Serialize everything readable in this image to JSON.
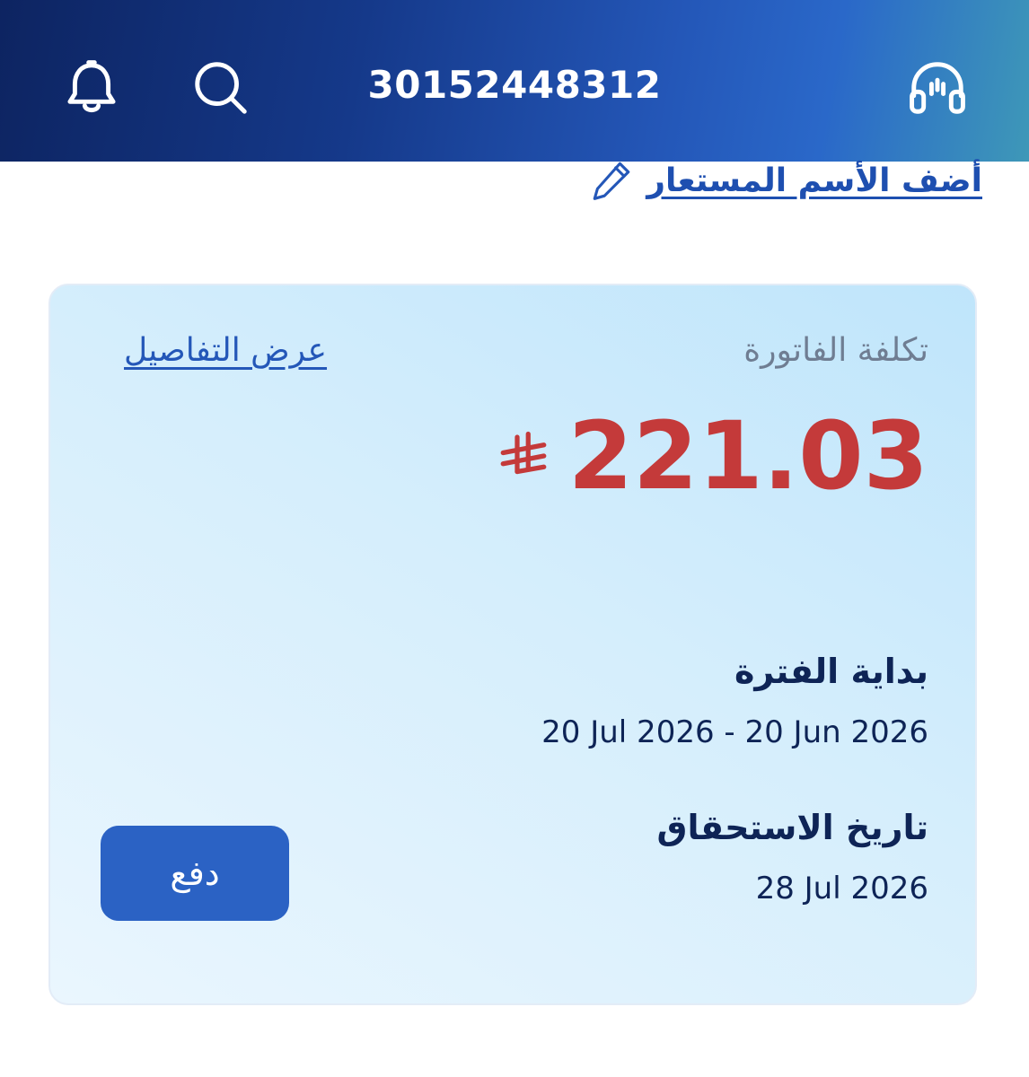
{
  "header": {
    "account_number": "30152448312",
    "icons": [
      "bell-icon",
      "search-icon",
      "headset-icon"
    ]
  },
  "nickname_link": {
    "label": "أضف الأسم المستعار",
    "icon": "pencil-icon"
  },
  "bill_card": {
    "title": "تكلفة الفاتورة",
    "details_link": "عرض التفاصيل",
    "amount": "221.03",
    "currency_icon": "riyal-symbol-icon",
    "period_label": "بداية الفترة",
    "period_value": "20 Jul 2026 - 20 Jun 2026",
    "due_label": "تاريخ الاستحقاق",
    "due_value": "28 Jul 2026",
    "pay_button": "دفع"
  },
  "colors": {
    "accent": "#2b62c4",
    "amount": "#c43a3a",
    "header_start": "#0d2461",
    "header_end": "#3e98b8",
    "text_dark": "#0e2456"
  }
}
